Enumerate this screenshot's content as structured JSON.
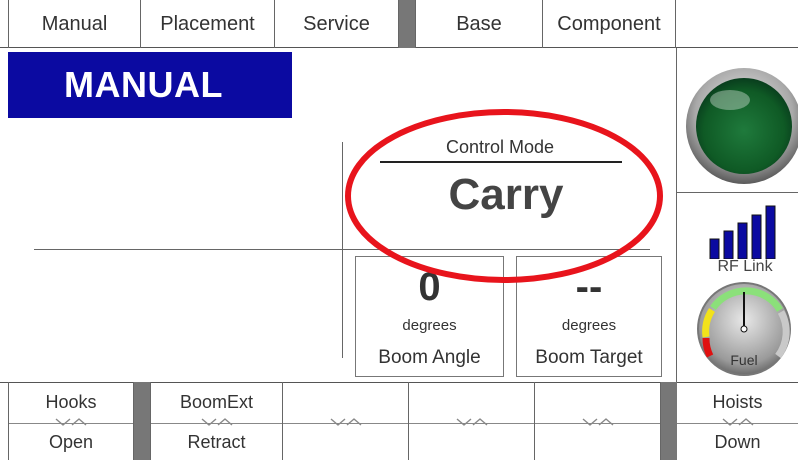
{
  "tabs": [
    {
      "label": "Manual"
    },
    {
      "label": "Placement"
    },
    {
      "label": "Service"
    },
    {
      "label": "Base"
    },
    {
      "label": "Component"
    }
  ],
  "mode_banner": "MANUAL",
  "control_mode": {
    "label": "Control Mode",
    "value": "Carry"
  },
  "boom_angle": {
    "value": "0",
    "unit": "degrees",
    "label": "Boom Angle"
  },
  "boom_target": {
    "value": "--",
    "unit": "degrees",
    "label": "Boom Target"
  },
  "rf_link": {
    "label": "RF Link",
    "bars": 5
  },
  "fuel": {
    "label": "Fuel"
  },
  "softkeys": [
    {
      "top": "Hooks",
      "bottom": "Open"
    },
    {
      "top": "BoomExt",
      "bottom": "Retract"
    },
    {
      "top": "",
      "bottom": ""
    },
    {
      "top": "",
      "bottom": ""
    },
    {
      "top": "",
      "bottom": ""
    },
    {
      "top": "Hoists",
      "bottom": "Down"
    }
  ],
  "colors": {
    "banner": "#0b0aa1",
    "highlight_ring": "#e8141c",
    "status_light": "#0f5a25",
    "signal_bars": "#0b0aa1"
  }
}
